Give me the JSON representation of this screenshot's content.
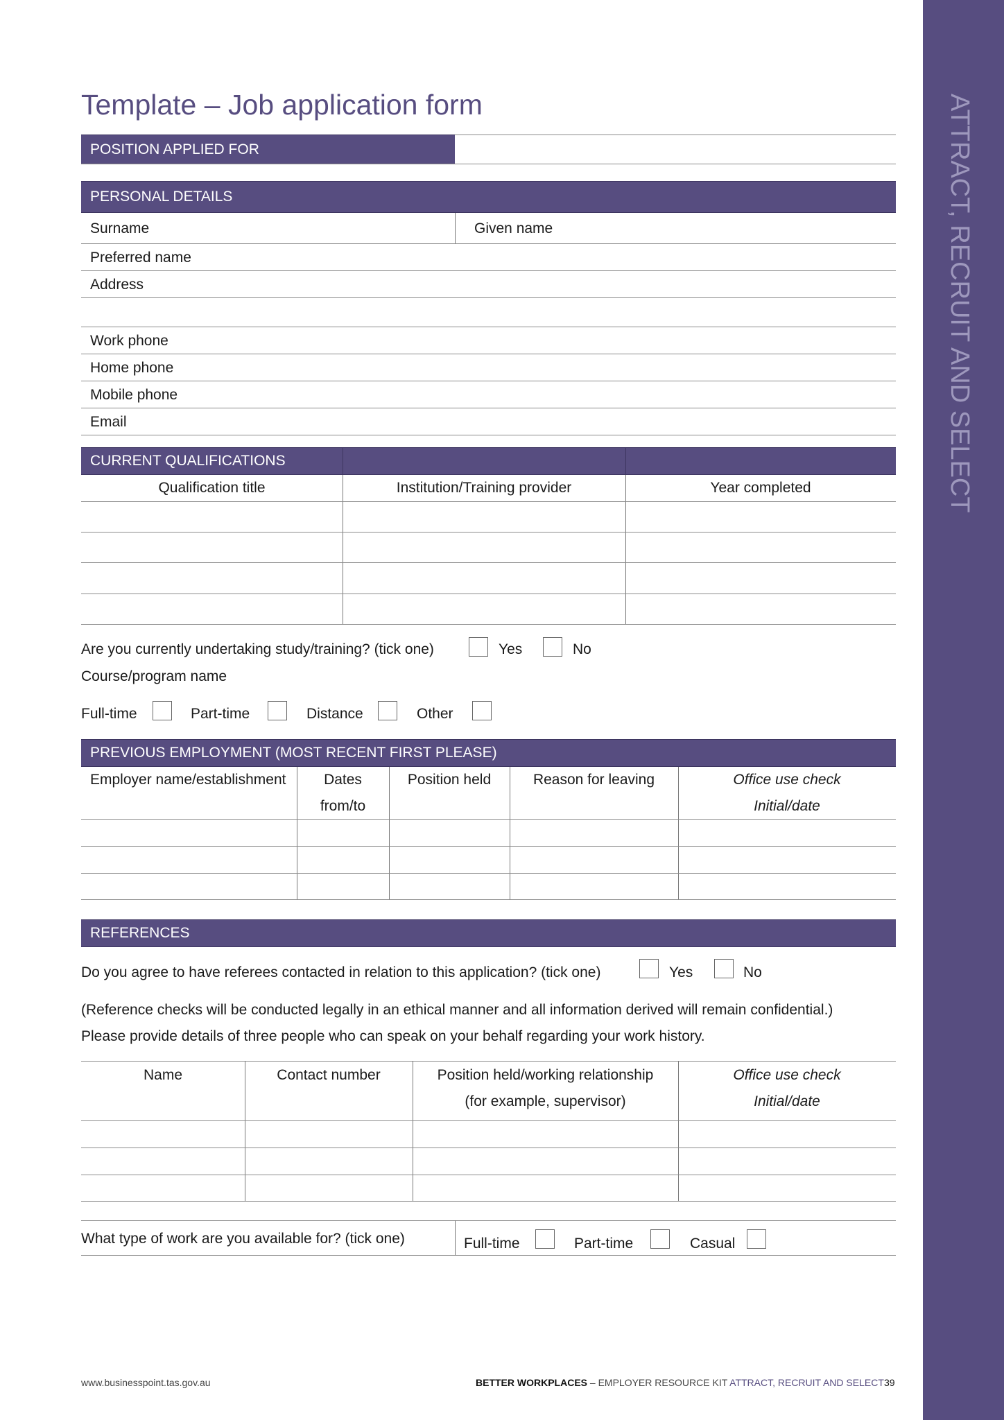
{
  "sidebar": {
    "label": "ATTRACT, RECRUIT AND SELECT"
  },
  "title": "Template – Job application form",
  "position": {
    "header": "POSITION APPLIED FOR",
    "value": ""
  },
  "personal": {
    "header": "PERSONAL DETAILS",
    "fields": {
      "surname": "Surname",
      "given_name": "Given name",
      "preferred_name": "Preferred name",
      "address": "Address",
      "work_phone": "Work phone",
      "home_phone": "Home phone",
      "mobile_phone": "Mobile phone",
      "email": "Email"
    }
  },
  "qualifications": {
    "header": "CURRENT QUALIFICATIONS",
    "columns": [
      "Qualification title",
      "Institution/Training provider",
      "Year completed"
    ],
    "rows": [
      [
        "",
        "",
        ""
      ],
      [
        "",
        "",
        ""
      ],
      [
        "",
        "",
        ""
      ],
      [
        "",
        "",
        ""
      ]
    ]
  },
  "study": {
    "question": "Are you currently undertaking study/training? (tick one)",
    "yes": "Yes",
    "no": "No",
    "course_label": "Course/program name",
    "modes": [
      "Full-time",
      "Part-time",
      "Distance",
      "Other"
    ]
  },
  "employment": {
    "header": "PREVIOUS EMPLOYMENT (MOST RECENT FIRST PLEASE)",
    "columns": [
      {
        "line1": "Employer name/establishment",
        "line2": ""
      },
      {
        "line1": "Dates",
        "line2": "from/to"
      },
      {
        "line1": "Position held",
        "line2": ""
      },
      {
        "line1": "Reason for leaving",
        "line2": ""
      },
      {
        "line1": "Office use check",
        "line2": "Initial/date"
      }
    ],
    "rows": [
      [
        "",
        "",
        "",
        "",
        ""
      ],
      [
        "",
        "",
        "",
        "",
        ""
      ],
      [
        "",
        "",
        "",
        "",
        ""
      ]
    ]
  },
  "references": {
    "header": "REFERENCES",
    "question": "Do you agree to have referees contacted in relation to this application? (tick one)",
    "yes": "Yes",
    "no": "No",
    "note": "(Reference checks will be conducted legally in an ethical manner and all information derived will remain confidential.)",
    "instruction": "Please provide details of three people who can speak on your behalf regarding your work history.",
    "columns": [
      {
        "line1": "Name",
        "line2": ""
      },
      {
        "line1": "Contact number",
        "line2": ""
      },
      {
        "line1": "Position held/working relationship",
        "line2": "(for example, supervisor)"
      },
      {
        "line1": "Office use check",
        "line2": "Initial/date"
      }
    ],
    "rows": [
      [
        "",
        "",
        "",
        ""
      ],
      [
        "",
        "",
        "",
        ""
      ],
      [
        "",
        "",
        "",
        ""
      ]
    ]
  },
  "availability": {
    "question": "What type of work are you available for? (tick one)",
    "options": [
      "Full-time",
      "Part-time",
      "Casual"
    ]
  },
  "footer": {
    "url": "www.businesspoint.tas.gov.au",
    "brand": "BETTER WORKPLACES",
    "dash": " – EMPLOYER RESOURCE KIT ",
    "section": "ATTRACT, RECRUIT AND SELECT",
    "page": "39"
  },
  "colors": {
    "accent": "#574d80",
    "sidebar_text": "#9e98bd"
  }
}
